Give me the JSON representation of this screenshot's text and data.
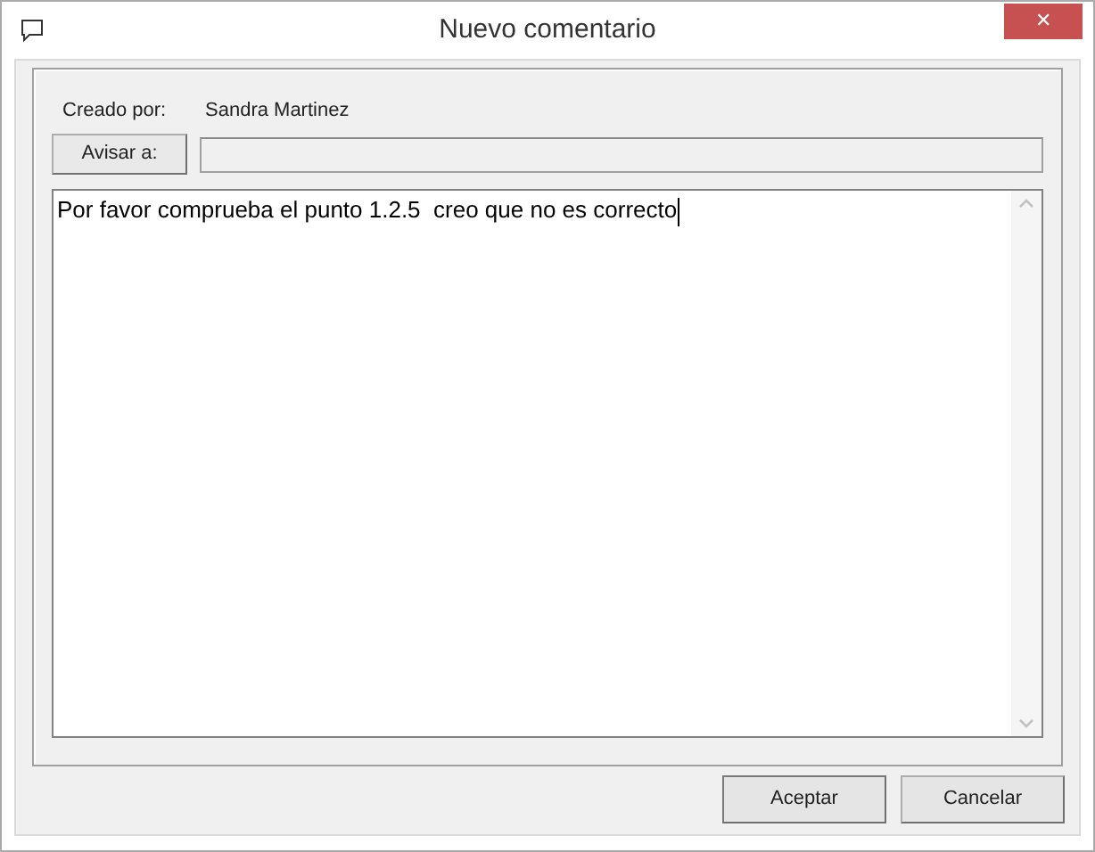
{
  "window": {
    "title": "Nuevo comentario",
    "close": "✕"
  },
  "created_by": {
    "label": "Creado por:",
    "value": "Sandra Martinez"
  },
  "notify": {
    "button": "Avisar a:"
  },
  "comment": {
    "value": "Por favor comprueba el punto 1.2.5  creo que no es correcto"
  },
  "buttons": [
    {
      "label": "Aceptar",
      "kind": "default"
    },
    {
      "label": "Cancelar",
      "kind": "cancel"
    }
  ]
}
